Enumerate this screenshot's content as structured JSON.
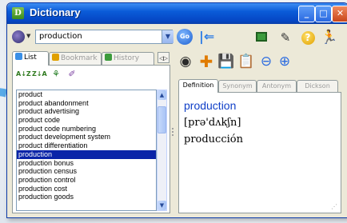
{
  "window": {
    "title": "Dictionary",
    "app_icon": "dictionary-icon"
  },
  "title_buttons": {
    "minimize": "_",
    "maximize": "□",
    "close": "✕"
  },
  "toolbar": {
    "search_value": "production",
    "go_label": "Go",
    "icons": [
      "language-selector-icon",
      "back-arrow-icon",
      "screen-icon",
      "pen-icon",
      "help-icon",
      "exit-icon"
    ]
  },
  "left_tabs": [
    {
      "label": "List",
      "active": true
    },
    {
      "label": "Bookmark",
      "active": false
    },
    {
      "label": "History",
      "active": false
    }
  ],
  "sort_icons": [
    "sort-az-icon",
    "sort-za-icon",
    "filter-icon",
    "edit-icon"
  ],
  "word_list": [
    "product",
    "product abandonment",
    "product advertising",
    "product code",
    "product code numbering",
    "product development system",
    "product differentiation",
    "production",
    "production bonus",
    "production census",
    "production control",
    "production cost",
    "production goods"
  ],
  "selected_index": 7,
  "action_icons": [
    "speak-icon",
    "add-icon",
    "save-icon",
    "note-icon",
    "zoom-out-icon",
    "zoom-in-icon"
  ],
  "definition_tabs": [
    {
      "label": "Definition",
      "active": true
    },
    {
      "label": "Synonym",
      "active": false
    },
    {
      "label": "Antonym",
      "active": false
    },
    {
      "label": "Dickson",
      "active": false
    }
  ],
  "definition": {
    "word": "production",
    "pronunciation": "[prə'dʌkʃn]",
    "translation": "producción"
  },
  "colors": {
    "title_bar": "#0a5bd8",
    "selection": "#0a24a8",
    "headword": "#1140c8"
  }
}
